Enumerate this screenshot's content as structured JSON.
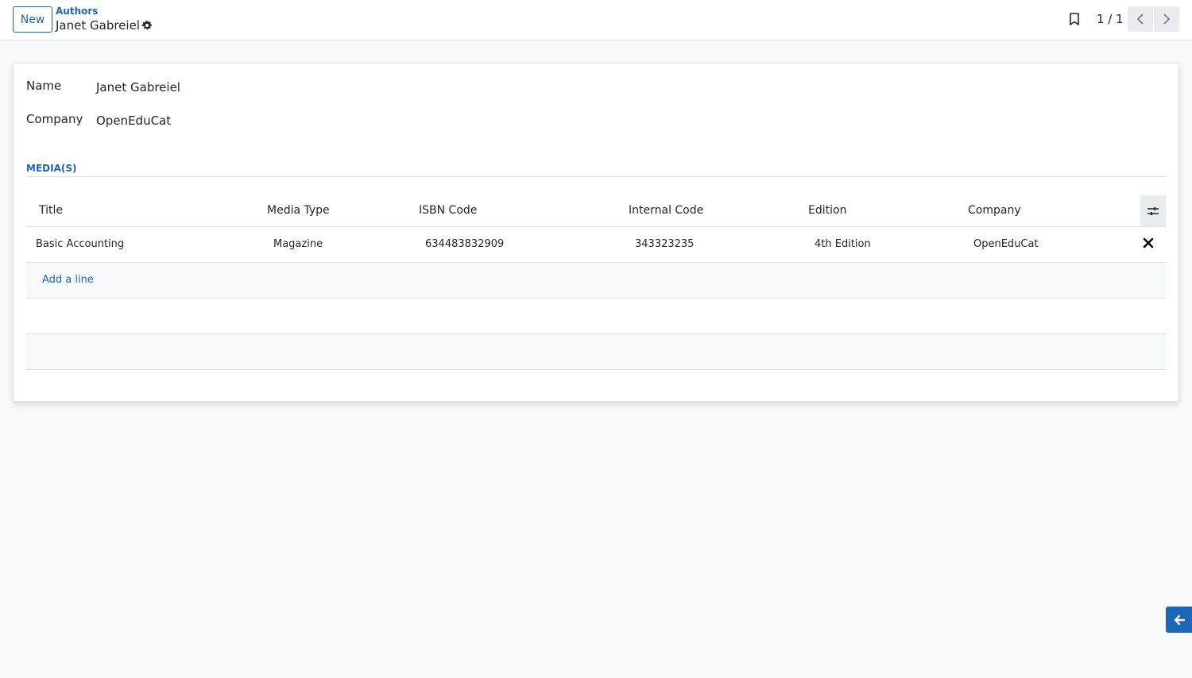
{
  "header": {
    "new_label": "New",
    "breadcrumb": "Authors",
    "record_title": "Janet Gabreiel",
    "pager": "1 / 1"
  },
  "form": {
    "name_label": "Name",
    "name_value": "Janet Gabreiel",
    "company_label": "Company",
    "company_value": "OpenEduCat"
  },
  "media": {
    "section_title": "MEDIA(S)",
    "columns": [
      "Title",
      "Media Type",
      "ISBN Code",
      "Internal Code",
      "Edition",
      "Company"
    ],
    "rows": [
      [
        "Basic Accounting",
        "Magazine",
        "634483832909",
        "343323235",
        "4th Edition",
        "OpenEduCat"
      ]
    ],
    "add_line": "Add a line"
  },
  "icons": {
    "gear": "gear-icon",
    "bookmark": "bookmark-icon",
    "prev": "chevron-left-icon",
    "next": "chevron-right-icon",
    "options": "sliders-icon",
    "delete": "close-icon",
    "back": "arrow-left-icon"
  },
  "colors": {
    "accent": "#1b66b8",
    "background": "#f8f9fa",
    "border": "#dee2e6"
  }
}
